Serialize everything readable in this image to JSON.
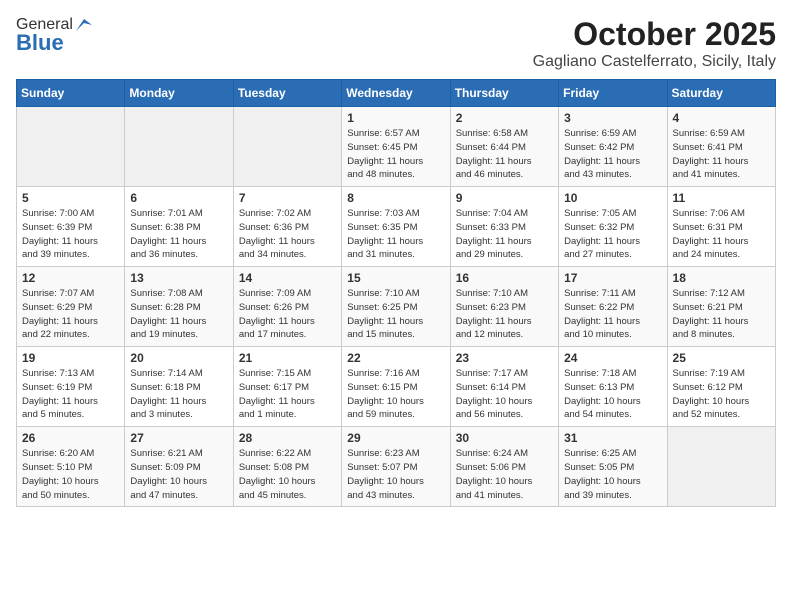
{
  "logo": {
    "general": "General",
    "blue": "Blue"
  },
  "header": {
    "month": "October 2025",
    "location": "Gagliano Castelferrato, Sicily, Italy"
  },
  "days_of_week": [
    "Sunday",
    "Monday",
    "Tuesday",
    "Wednesday",
    "Thursday",
    "Friday",
    "Saturday"
  ],
  "weeks": [
    [
      {
        "day": "",
        "info": ""
      },
      {
        "day": "",
        "info": ""
      },
      {
        "day": "",
        "info": ""
      },
      {
        "day": "1",
        "info": "Sunrise: 6:57 AM\nSunset: 6:45 PM\nDaylight: 11 hours\nand 48 minutes."
      },
      {
        "day": "2",
        "info": "Sunrise: 6:58 AM\nSunset: 6:44 PM\nDaylight: 11 hours\nand 46 minutes."
      },
      {
        "day": "3",
        "info": "Sunrise: 6:59 AM\nSunset: 6:42 PM\nDaylight: 11 hours\nand 43 minutes."
      },
      {
        "day": "4",
        "info": "Sunrise: 6:59 AM\nSunset: 6:41 PM\nDaylight: 11 hours\nand 41 minutes."
      }
    ],
    [
      {
        "day": "5",
        "info": "Sunrise: 7:00 AM\nSunset: 6:39 PM\nDaylight: 11 hours\nand 39 minutes."
      },
      {
        "day": "6",
        "info": "Sunrise: 7:01 AM\nSunset: 6:38 PM\nDaylight: 11 hours\nand 36 minutes."
      },
      {
        "day": "7",
        "info": "Sunrise: 7:02 AM\nSunset: 6:36 PM\nDaylight: 11 hours\nand 34 minutes."
      },
      {
        "day": "8",
        "info": "Sunrise: 7:03 AM\nSunset: 6:35 PM\nDaylight: 11 hours\nand 31 minutes."
      },
      {
        "day": "9",
        "info": "Sunrise: 7:04 AM\nSunset: 6:33 PM\nDaylight: 11 hours\nand 29 minutes."
      },
      {
        "day": "10",
        "info": "Sunrise: 7:05 AM\nSunset: 6:32 PM\nDaylight: 11 hours\nand 27 minutes."
      },
      {
        "day": "11",
        "info": "Sunrise: 7:06 AM\nSunset: 6:31 PM\nDaylight: 11 hours\nand 24 minutes."
      }
    ],
    [
      {
        "day": "12",
        "info": "Sunrise: 7:07 AM\nSunset: 6:29 PM\nDaylight: 11 hours\nand 22 minutes."
      },
      {
        "day": "13",
        "info": "Sunrise: 7:08 AM\nSunset: 6:28 PM\nDaylight: 11 hours\nand 19 minutes."
      },
      {
        "day": "14",
        "info": "Sunrise: 7:09 AM\nSunset: 6:26 PM\nDaylight: 11 hours\nand 17 minutes."
      },
      {
        "day": "15",
        "info": "Sunrise: 7:10 AM\nSunset: 6:25 PM\nDaylight: 11 hours\nand 15 minutes."
      },
      {
        "day": "16",
        "info": "Sunrise: 7:10 AM\nSunset: 6:23 PM\nDaylight: 11 hours\nand 12 minutes."
      },
      {
        "day": "17",
        "info": "Sunrise: 7:11 AM\nSunset: 6:22 PM\nDaylight: 11 hours\nand 10 minutes."
      },
      {
        "day": "18",
        "info": "Sunrise: 7:12 AM\nSunset: 6:21 PM\nDaylight: 11 hours\nand 8 minutes."
      }
    ],
    [
      {
        "day": "19",
        "info": "Sunrise: 7:13 AM\nSunset: 6:19 PM\nDaylight: 11 hours\nand 5 minutes."
      },
      {
        "day": "20",
        "info": "Sunrise: 7:14 AM\nSunset: 6:18 PM\nDaylight: 11 hours\nand 3 minutes."
      },
      {
        "day": "21",
        "info": "Sunrise: 7:15 AM\nSunset: 6:17 PM\nDaylight: 11 hours\nand 1 minute."
      },
      {
        "day": "22",
        "info": "Sunrise: 7:16 AM\nSunset: 6:15 PM\nDaylight: 10 hours\nand 59 minutes."
      },
      {
        "day": "23",
        "info": "Sunrise: 7:17 AM\nSunset: 6:14 PM\nDaylight: 10 hours\nand 56 minutes."
      },
      {
        "day": "24",
        "info": "Sunrise: 7:18 AM\nSunset: 6:13 PM\nDaylight: 10 hours\nand 54 minutes."
      },
      {
        "day": "25",
        "info": "Sunrise: 7:19 AM\nSunset: 6:12 PM\nDaylight: 10 hours\nand 52 minutes."
      }
    ],
    [
      {
        "day": "26",
        "info": "Sunrise: 6:20 AM\nSunset: 5:10 PM\nDaylight: 10 hours\nand 50 minutes."
      },
      {
        "day": "27",
        "info": "Sunrise: 6:21 AM\nSunset: 5:09 PM\nDaylight: 10 hours\nand 47 minutes."
      },
      {
        "day": "28",
        "info": "Sunrise: 6:22 AM\nSunset: 5:08 PM\nDaylight: 10 hours\nand 45 minutes."
      },
      {
        "day": "29",
        "info": "Sunrise: 6:23 AM\nSunset: 5:07 PM\nDaylight: 10 hours\nand 43 minutes."
      },
      {
        "day": "30",
        "info": "Sunrise: 6:24 AM\nSunset: 5:06 PM\nDaylight: 10 hours\nand 41 minutes."
      },
      {
        "day": "31",
        "info": "Sunrise: 6:25 AM\nSunset: 5:05 PM\nDaylight: 10 hours\nand 39 minutes."
      },
      {
        "day": "",
        "info": ""
      }
    ]
  ]
}
